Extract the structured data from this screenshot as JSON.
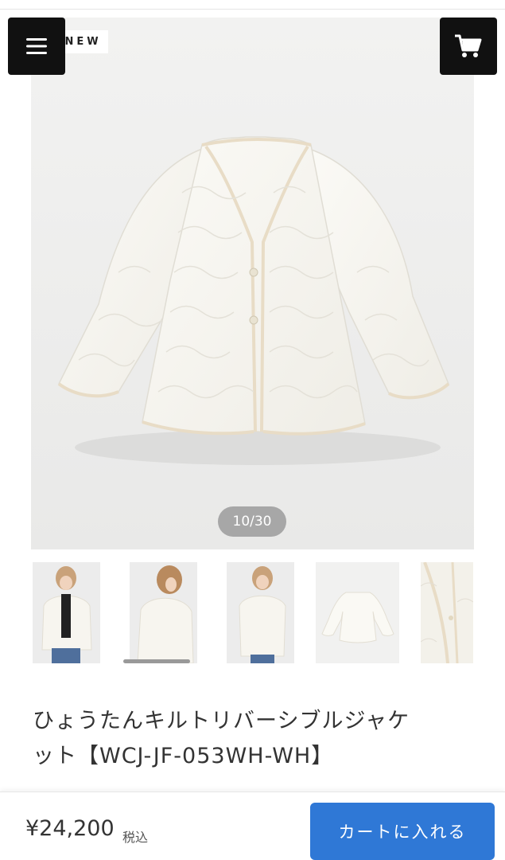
{
  "header": {
    "menu_icon": "hamburger-menu-icon",
    "cart_icon": "shopping-cart-icon"
  },
  "gallery": {
    "badge": "NEW",
    "counter": "10/30",
    "thumbnails": [
      "model-front",
      "model-side",
      "model-back",
      "jacket-flat",
      "jacket-detail"
    ]
  },
  "product": {
    "title_line1": "ひょうたんキルトリバーシブルジャケ",
    "title_line2": "ット【WCJ-JF-053WH-WH】"
  },
  "purchase": {
    "price": "¥24,200",
    "tax_label": "税込",
    "add_to_cart_label": "カートに入れる"
  },
  "colors": {
    "accent": "#2f78d6",
    "header_button": "#111111",
    "counter_bg": "#a7a7a7"
  }
}
